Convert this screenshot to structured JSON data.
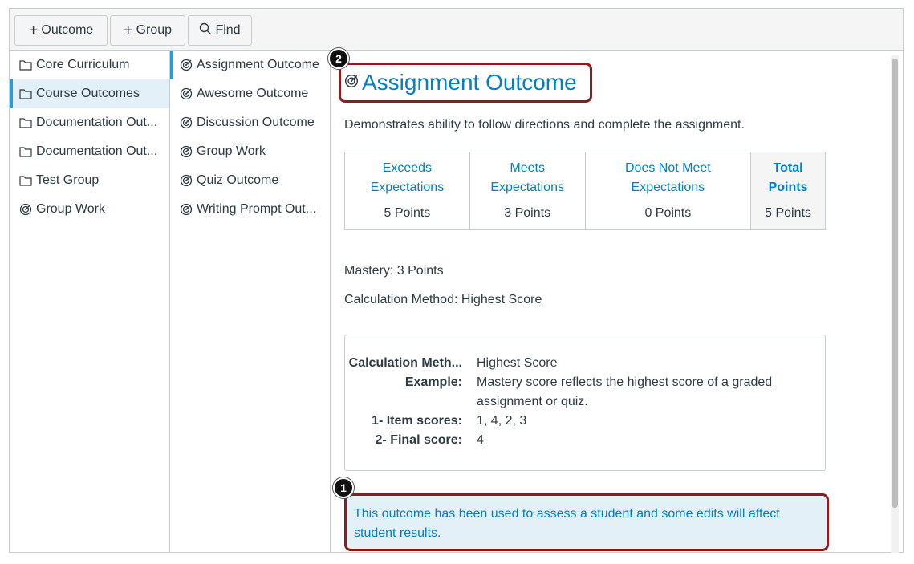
{
  "toolbar": {
    "outcome_label": "Outcome",
    "group_label": "Group",
    "find_label": "Find"
  },
  "groups": [
    {
      "label": "Core Curriculum",
      "icon": "folder-icon",
      "active": false
    },
    {
      "label": "Course Outcomes",
      "icon": "folder-icon",
      "active": true
    },
    {
      "label": "Documentation Out...",
      "icon": "folder-icon",
      "active": false
    },
    {
      "label": "Documentation Out...",
      "icon": "folder-icon",
      "active": false
    },
    {
      "label": "Test Group",
      "icon": "folder-icon",
      "active": false
    },
    {
      "label": "Group Work",
      "icon": "outcome-target-icon",
      "active": false
    }
  ],
  "outcomes": [
    {
      "label": "Assignment Outcome",
      "active": true
    },
    {
      "label": "Awesome Outcome",
      "active": false
    },
    {
      "label": "Discussion Outcome",
      "active": false
    },
    {
      "label": "Group Work",
      "active": false
    },
    {
      "label": "Quiz Outcome",
      "active": false
    },
    {
      "label": "Writing Prompt Out...",
      "active": false
    }
  ],
  "detail": {
    "title": "Assignment Outcome",
    "description": "Demonstrates ability to follow directions and complete the assignment.",
    "rubric": [
      {
        "label_1": "Exceeds",
        "label_2": "Expectations",
        "points": "5 Points"
      },
      {
        "label_1": "Meets",
        "label_2": "Expectations",
        "points": "3 Points"
      },
      {
        "label_1": "Does Not Meet",
        "label_2": "Expectations",
        "points": "0 Points"
      },
      {
        "label_1": "Total",
        "label_2": "Points",
        "points": "5 Points"
      }
    ],
    "mastery": "Mastery: 3 Points",
    "calculation_method": "Calculation Method: Highest Score",
    "calc_box": {
      "method_key": "Calculation Meth...",
      "method_value": "Highest Score",
      "example_key": "Example:",
      "example_value": "Mastery score reflects the highest score of a graded assignment or quiz.",
      "item_scores_key": "1- Item scores:",
      "item_scores_value": "1, 4, 2, 3",
      "final_score_key": "2- Final score:",
      "final_score_value": "4"
    },
    "warning": "This outcome has been used to assess a student and some edits will affect student results."
  },
  "callouts": {
    "one": "1",
    "two": "2"
  },
  "colors": {
    "link_blue": "#0081c6",
    "active_bar": "#2d9ad6",
    "highlight_bg": "#e4f0f8",
    "callout_border": "#8d1b1f"
  }
}
